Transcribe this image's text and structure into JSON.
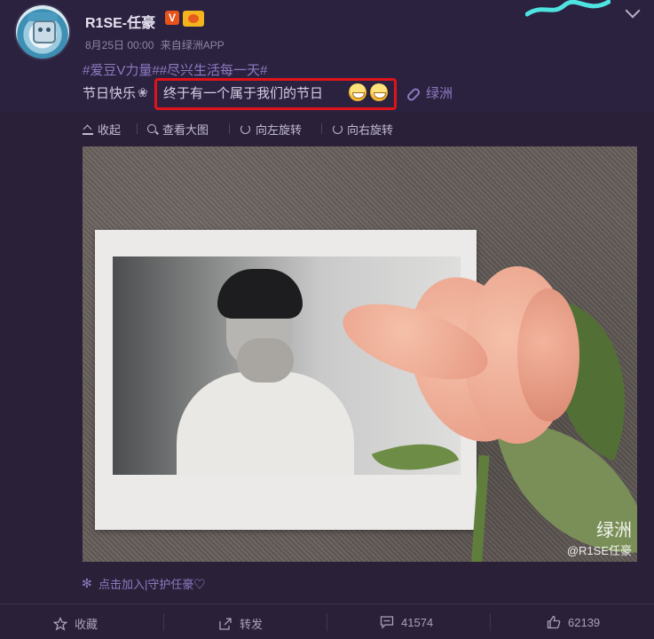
{
  "post": {
    "username": "R1SE-任豪",
    "badge_v": "V",
    "date": "8月25日 00:00",
    "source_prefix": "来自",
    "source": "绿洲APP",
    "hashtags": "#爱豆V力量##尽兴生活每一天#",
    "text_start": "节日快乐",
    "text_highlighted": "终于有一个属于我们的节日",
    "link_label": "绿洲"
  },
  "toolbar": {
    "collapse": "收起",
    "view_large": "查看大图",
    "rotate_left": "向左旋转",
    "rotate_right": "向右旋转"
  },
  "photo": {
    "watermark_brand": "绿洲",
    "watermark_user": "@R1SE任豪"
  },
  "fan_link": "点击加入|守护任豪♡",
  "actions": {
    "favorite": "收藏",
    "repost": "转发",
    "comments": "41574",
    "likes": "62139"
  },
  "icons": {
    "collapse": "arrow-up-icon",
    "view_large": "search-icon",
    "rotate_left": "rotate-left-icon",
    "rotate_right": "rotate-right-icon",
    "link": "link-icon",
    "favorite": "star-icon",
    "repost": "share-icon",
    "comment": "comment-icon",
    "like": "thumbs-up-icon"
  },
  "colors": {
    "background": "#2a2139",
    "highlight_border": "#e0131a",
    "link": "#8d7ac0",
    "badge_v": "#e8531c"
  }
}
